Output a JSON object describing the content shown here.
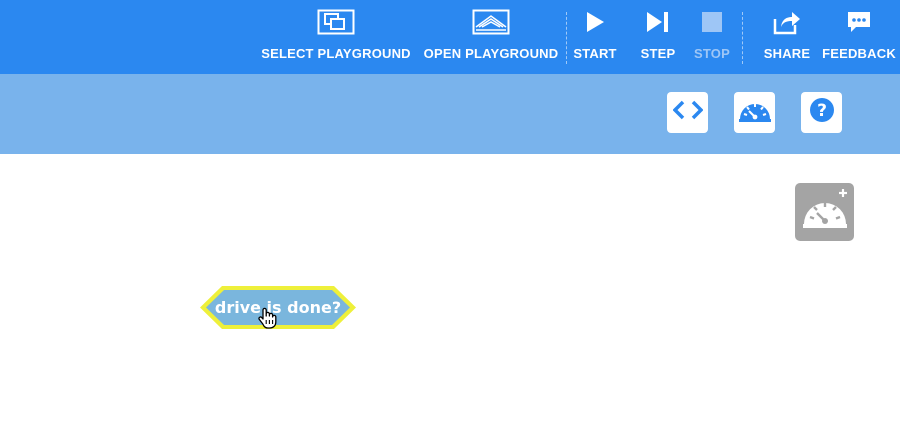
{
  "toolbar": {
    "select_playground": "SELECT PLAYGROUND",
    "open_playground": "OPEN PLAYGROUND",
    "start": "START",
    "step": "STEP",
    "stop": "STOP",
    "share": "SHARE",
    "feedback": "FEEDBACK"
  },
  "subbar": {
    "buttons": [
      "code-icon",
      "dashboard-icon",
      "help-icon"
    ]
  },
  "canvas": {
    "block_text": "drive is done?",
    "add_dashboard_icon": "dashboard-add-icon"
  },
  "colors": {
    "topbar": "#2b88f0",
    "subbar": "#79b3ec",
    "block_fill": "#7ab6dd",
    "block_highlight": "#eef03a",
    "stop_disabled": "#9ec6f6"
  }
}
